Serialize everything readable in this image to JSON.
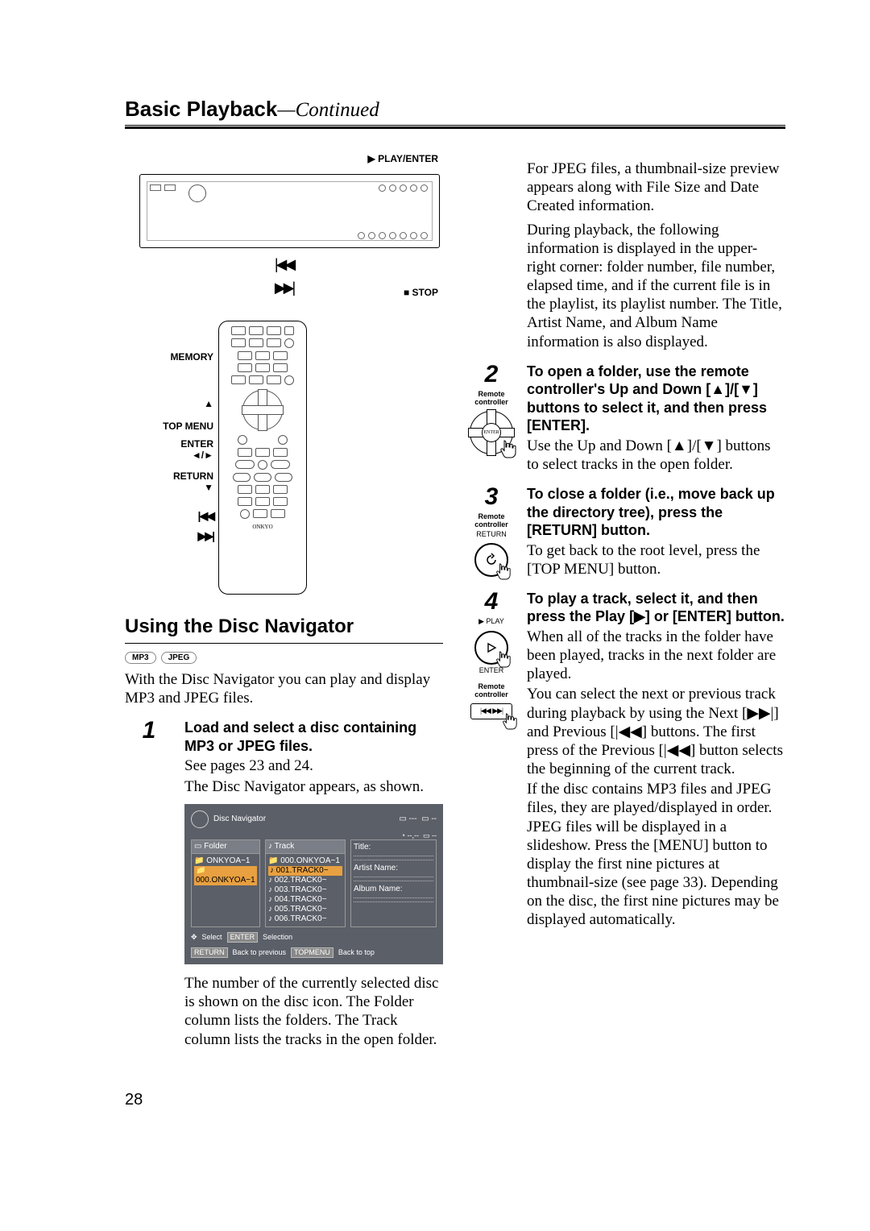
{
  "header": {
    "title": "Basic Playback",
    "continued": "—Continued"
  },
  "deviceLabels": {
    "playEnter": "PLAY/ENTER",
    "stop": "STOP",
    "memory": "MEMORY",
    "topMenu": "TOP MENU",
    "enter": "ENTER",
    "return": "RETURN"
  },
  "section": {
    "title": "Using the Disc Navigator",
    "badges": {
      "mp3": "MP3",
      "jpeg": "JPEG"
    },
    "intro": "With the Disc Navigator you can play and display MP3 and JPEG files."
  },
  "navBox": {
    "title": "Disc Navigator",
    "folderHeader": "Folder",
    "trackHeader": "Track",
    "folders": [
      "ONKYOA~1",
      "000.ONKYOA~1"
    ],
    "tracks": [
      "000.ONKYOA~1",
      "001.TRACK0~",
      "002.TRACK0~",
      "003.TRACK0~",
      "004.TRACK0~",
      "005.TRACK0~",
      "006.TRACK0~"
    ],
    "metaTitle": "Title:",
    "metaArtist": "Artist Name:",
    "metaAlbum": "Album Name:",
    "footerSelect": "Select",
    "footerEnter": "ENTER",
    "footerSelection": "Selection",
    "footerReturn": "RETURN",
    "footerBack": "Back to previous",
    "footerTopmenu": "TOPMENU",
    "footerTop": "Back to top"
  },
  "steps": {
    "s1": {
      "num": "1",
      "bold": "Load and select a disc containing MP3 or JPEG files.",
      "line1": "See pages 23 and 24.",
      "line2": "The Disc Navigator appears, as shown.",
      "post": "The number of the currently selected disc is shown on the disc icon. The Folder column lists the folders. The Track column lists the tracks in the open folder."
    },
    "topRight": {
      "p1": "For JPEG files, a thumbnail-size preview appears along with File Size and Date Created information.",
      "p2": "During playback, the following information is displayed in the upper-right corner: folder number, file number, elapsed time, and if the current file is in the playlist, its playlist number. The Title, Artist Name, and Album Name information is also displayed."
    },
    "s2": {
      "num": "2",
      "sub": "Remote controller",
      "enter": "ENTER",
      "bold": "To open a folder, use the remote controller's Up and Down [▲]/[▼] buttons to select it, and then press [ENTER].",
      "text": "Use the Up and Down [▲]/[▼] buttons to select tracks in the open folder."
    },
    "s3": {
      "num": "3",
      "sub": "Remote controller",
      "iconLabel": "RETURN",
      "bold": "To close a folder (i.e., move back up the directory tree), press the [RETURN] button.",
      "text": "To get back to the root level, press the [TOP MENU] button."
    },
    "s4": {
      "num": "4",
      "playLabel": "PLAY",
      "enterLabel": "ENTER",
      "sub": "Remote controller",
      "bold": "To play a track, select it, and then press the Play [▶] or [ENTER] button.",
      "p1": "When all of the tracks in the folder have been played, tracks in the next folder are played.",
      "p2": "You can select the next or previous track during playback by using the Next [▶▶|] and Previous [|◀◀] buttons. The first press of the Previous [|◀◀] button selects the beginning of the current track.",
      "p3": "If the disc contains MP3 files and JPEG files, they are played/displayed in order. JPEG files will be displayed in a slideshow. Press the [MENU] button to display the first nine pictures at thumbnail-size (see page 33). Depending on the disc, the first nine pictures may be displayed automatically."
    }
  },
  "pageNumber": "28"
}
